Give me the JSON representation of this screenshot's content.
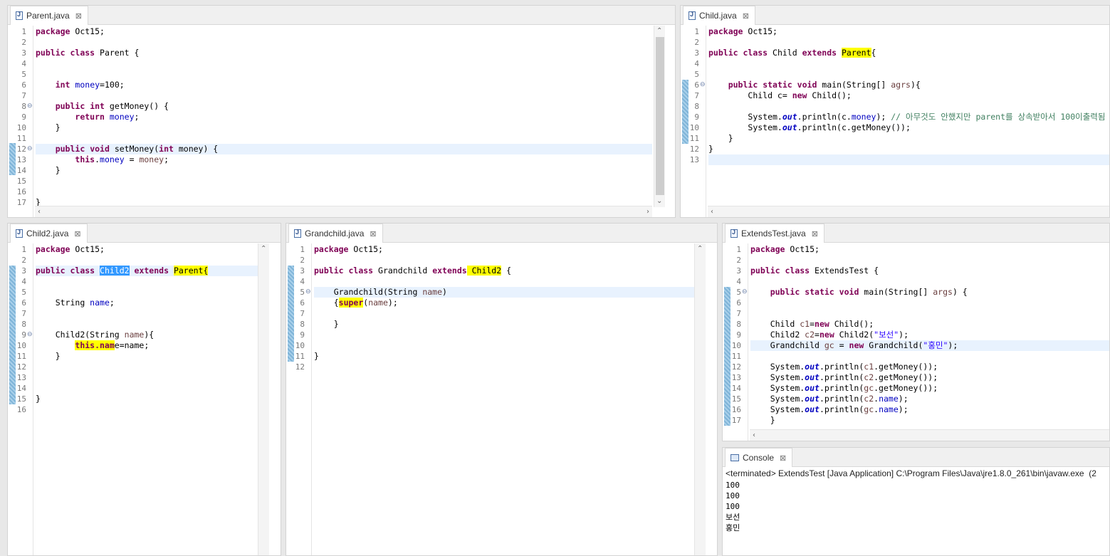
{
  "editors": {
    "parent": {
      "tab": "Parent.java",
      "lines": [
        "1",
        "2",
        "3",
        "4",
        "5",
        "6",
        "7",
        "8",
        "9",
        "10",
        "11",
        "12",
        "13",
        "14",
        "15",
        "16",
        "17"
      ]
    },
    "child": {
      "tab": "Child.java"
    },
    "child2": {
      "tab": "Child2.java"
    },
    "grandchild": {
      "tab": "Grandchild.java"
    },
    "extendstest": {
      "tab": "ExtendsTest.java"
    }
  },
  "code": {
    "package_kw": "package",
    "package_name": " Oct15;",
    "public": "public",
    "class": "class",
    "static": "static",
    "void": "void",
    "int": "int",
    "return": "return",
    "this": "this",
    "new": "new",
    "extends": "extends",
    "super": "super",
    "parent_l3": " Parent {",
    "parent_money_decl": "money",
    "parent_l6_rest": "=100;",
    "parent_l8_rest": " getMoney() {",
    "parent_l9_rest": ";",
    "brace_close": "}",
    "parent_l12_a": " setMoney(",
    "parent_l12_b": " money) {",
    "parent_l13_dot": ".",
    "parent_l13_eq": " = ",
    "parent_l13_end": ";",
    "child_l3_a": " Child ",
    "child_l3_parent": "Parent",
    "child_l3_brace": "{",
    "main_sig_a": " main(String[] ",
    "main_param_child": "agrs",
    "main_sig_end": "){",
    "child_l7_a": "Child c= ",
    "child_l7_b": " Child();",
    "sys_a": "System.",
    "out": "out",
    "child_l9_b": ".println(c.",
    "money": "money",
    "child_l9_c": "); ",
    "child_l9_comment": "// 아무것도 안했지만 parent를 상속받아서 100이출력됨",
    "child_l10_b": ".println(c.getMoney());",
    "child2_name": "Child2",
    "parent_brace": "Parent{",
    "child2_l6_a": "String ",
    "name": "name",
    "child2_l6_end": ";",
    "child2_l9_a": "Child2(String ",
    "child2_l9_end": "){",
    "child2_l10_hl": "this.nam",
    "child2_l10_rest": "e=name;",
    "gc_l3_a": " Grandchild ",
    "gc_child2": " Child2",
    "gc_l3_end": " {",
    "gc_l5_a": "Grandchild(String ",
    "gc_l5_end": ")",
    "gc_l6_open": "{",
    "gc_l6_a": "(",
    "gc_l6_end": ");",
    "et_l3_a": " ExtendsTest {",
    "et_main_param": "args",
    "et_main_end": ") {",
    "et_l8_a": "Child ",
    "et_c1": "c1",
    "et_l8_b": "=",
    "et_l8_c": " Child();",
    "et_l9_a": "Child2 ",
    "et_c2": "c2",
    "et_l9_c": " Child2(",
    "et_str_boseon": "\"보선\"",
    "et_l9_end": ");",
    "et_l10_a": "Grandchild ",
    "et_gc": "gc",
    "et_l10_b": " = ",
    "et_l10_c": " Grandchild(",
    "et_str_hongmin": "\"홍민\"",
    "println_open": ".println(",
    "getmoney_end": ".getMoney());",
    "dot": ".",
    "paren_end": ");"
  },
  "console": {
    "tab": "Console",
    "header": "<terminated> ExtendsTest [Java Application] C:\\Program Files\\Java\\jre1.8.0_261\\bin\\javaw.exe  (2",
    "output": [
      "100",
      "100",
      "100",
      "보선",
      "홍민"
    ]
  },
  "icons": {
    "file": "java-file-icon",
    "close": "close-icon",
    "console": "console-icon",
    "fold": "fold-minus-icon"
  }
}
